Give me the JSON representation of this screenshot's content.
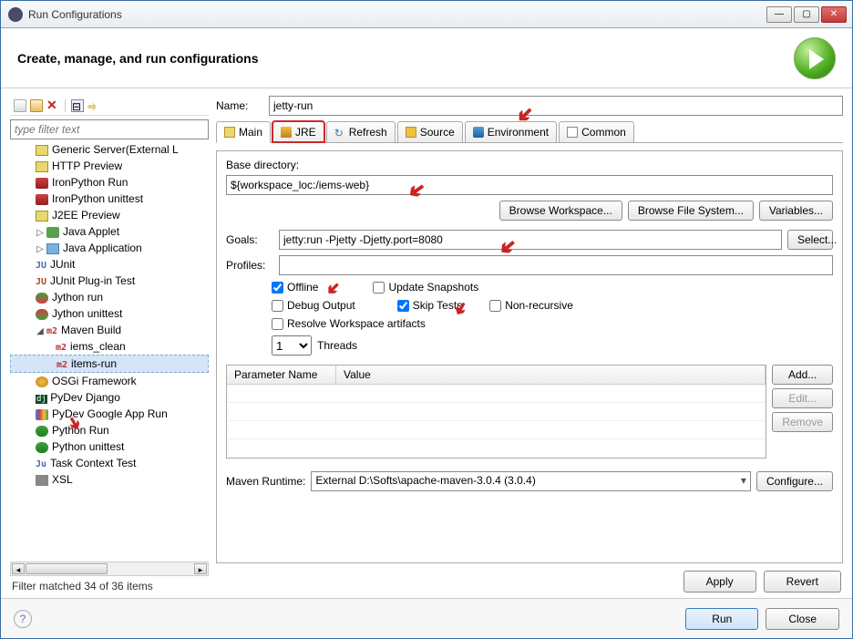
{
  "window": {
    "title": "Run Configurations"
  },
  "header": {
    "title": "Create, manage, and run configurations"
  },
  "filter": {
    "placeholder": "type filter text",
    "status": "Filter matched 34 of 36 items"
  },
  "tree": {
    "items": [
      "Generic Server(External L",
      "HTTP Preview",
      "IronPython Run",
      "IronPython unittest",
      "J2EE Preview",
      "Java Applet",
      "Java Application",
      "JUnit",
      "JUnit Plug-in Test",
      "Jython run",
      "Jython unittest",
      "Maven Build",
      "iems_clean",
      "items-run",
      "OSGi Framework",
      "PyDev Django",
      "PyDev Google App Run",
      "Python Run",
      "Python unittest",
      "Task Context Test",
      "XSL"
    ]
  },
  "form": {
    "name_label": "Name:",
    "name_value": "jetty-run",
    "tabs": {
      "main": "Main",
      "jre": "JRE",
      "refresh": "Refresh",
      "source": "Source",
      "environment": "Environment",
      "common": "Common"
    },
    "base_dir_label": "Base directory:",
    "base_dir_value": "${workspace_loc:/iems-web}",
    "browse_ws": "Browse Workspace...",
    "browse_fs": "Browse File System...",
    "variables": "Variables...",
    "goals_label": "Goals:",
    "goals_value": "jetty:run -Pjetty -Djetty.port=8080",
    "select": "Select...",
    "profiles_label": "Profiles:",
    "profiles_value": "",
    "checks": {
      "offline": "Offline",
      "update": "Update Snapshots",
      "debug": "Debug Output",
      "skip": "Skip Tests",
      "nonrec": "Non-recursive",
      "resolve": "Resolve Workspace artifacts"
    },
    "threads_val": "1",
    "threads_label": "Threads",
    "param_name": "Parameter Name",
    "param_value": "Value",
    "add": "Add...",
    "edit": "Edit...",
    "remove": "Remove",
    "runtime_label": "Maven Runtime:",
    "runtime_value": "External D:\\Softs\\apache-maven-3.0.4 (3.0.4)",
    "configure": "Configure...",
    "apply": "Apply",
    "revert": "Revert"
  },
  "footer": {
    "run": "Run",
    "close": "Close"
  }
}
